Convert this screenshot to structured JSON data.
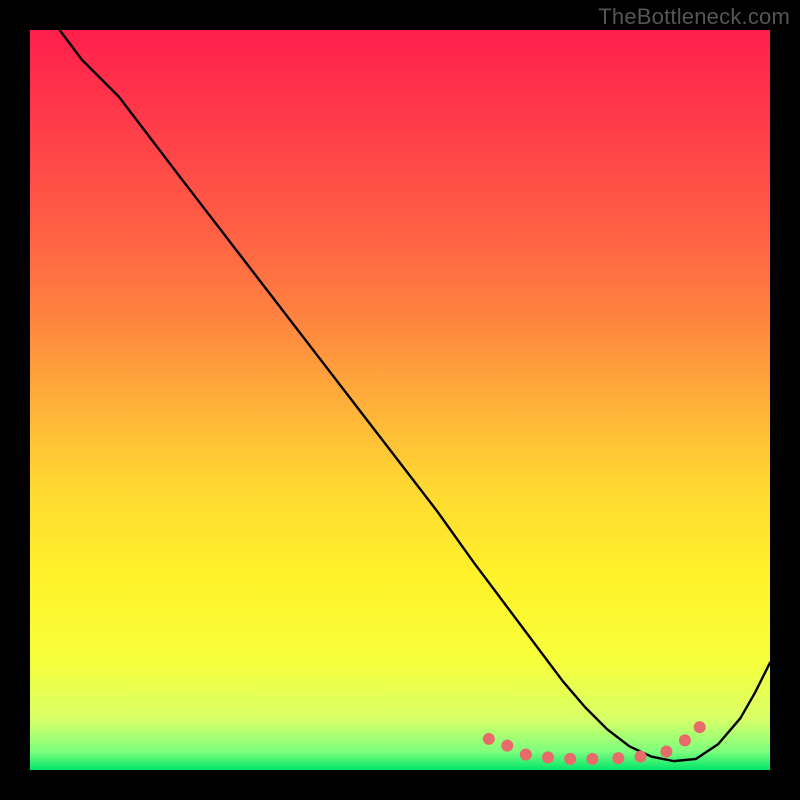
{
  "watermark": "TheBottleneck.com",
  "gradient": {
    "stops": [
      {
        "offset": 0.0,
        "color": "#ff1f4b"
      },
      {
        "offset": 0.12,
        "color": "#ff3a4a"
      },
      {
        "offset": 0.25,
        "color": "#ff5a45"
      },
      {
        "offset": 0.38,
        "color": "#ff8040"
      },
      {
        "offset": 0.5,
        "color": "#ffae3a"
      },
      {
        "offset": 0.62,
        "color": "#ffd932"
      },
      {
        "offset": 0.74,
        "color": "#fff22a"
      },
      {
        "offset": 0.85,
        "color": "#f7ff3a"
      },
      {
        "offset": 0.93,
        "color": "#d9ff66"
      },
      {
        "offset": 0.975,
        "color": "#7dff7d"
      },
      {
        "offset": 1.0,
        "color": "#00e66a"
      }
    ]
  },
  "chart_data": {
    "type": "line",
    "title": "",
    "xlabel": "",
    "ylabel": "",
    "xlim": [
      0,
      100
    ],
    "ylim": [
      0,
      100
    ],
    "series": [
      {
        "name": "curve",
        "x": [
          4,
          7,
          12,
          20,
          30,
          40,
          50,
          55,
          60,
          63,
          66,
          69,
          72,
          75,
          78,
          81,
          84,
          87,
          90,
          93,
          96,
          98,
          100
        ],
        "y": [
          100,
          96,
          91,
          80.5,
          67.5,
          54.5,
          41.5,
          35,
          28,
          24,
          20,
          16,
          12,
          8.5,
          5.5,
          3.2,
          1.8,
          1.2,
          1.5,
          3.5,
          7,
          10.5,
          14.5
        ]
      }
    ],
    "markers": {
      "name": "dots",
      "x": [
        62,
        64.5,
        67,
        70,
        73,
        76,
        79.5,
        82.5,
        86,
        88.5,
        90.5
      ],
      "y": [
        4.2,
        3.3,
        2.1,
        1.7,
        1.5,
        1.5,
        1.6,
        1.8,
        2.5,
        4.0,
        5.8
      ]
    }
  },
  "styles": {
    "curve_color": "#000000",
    "curve_width": 2.4,
    "marker_color": "#e96a6a",
    "marker_radius": 6
  }
}
